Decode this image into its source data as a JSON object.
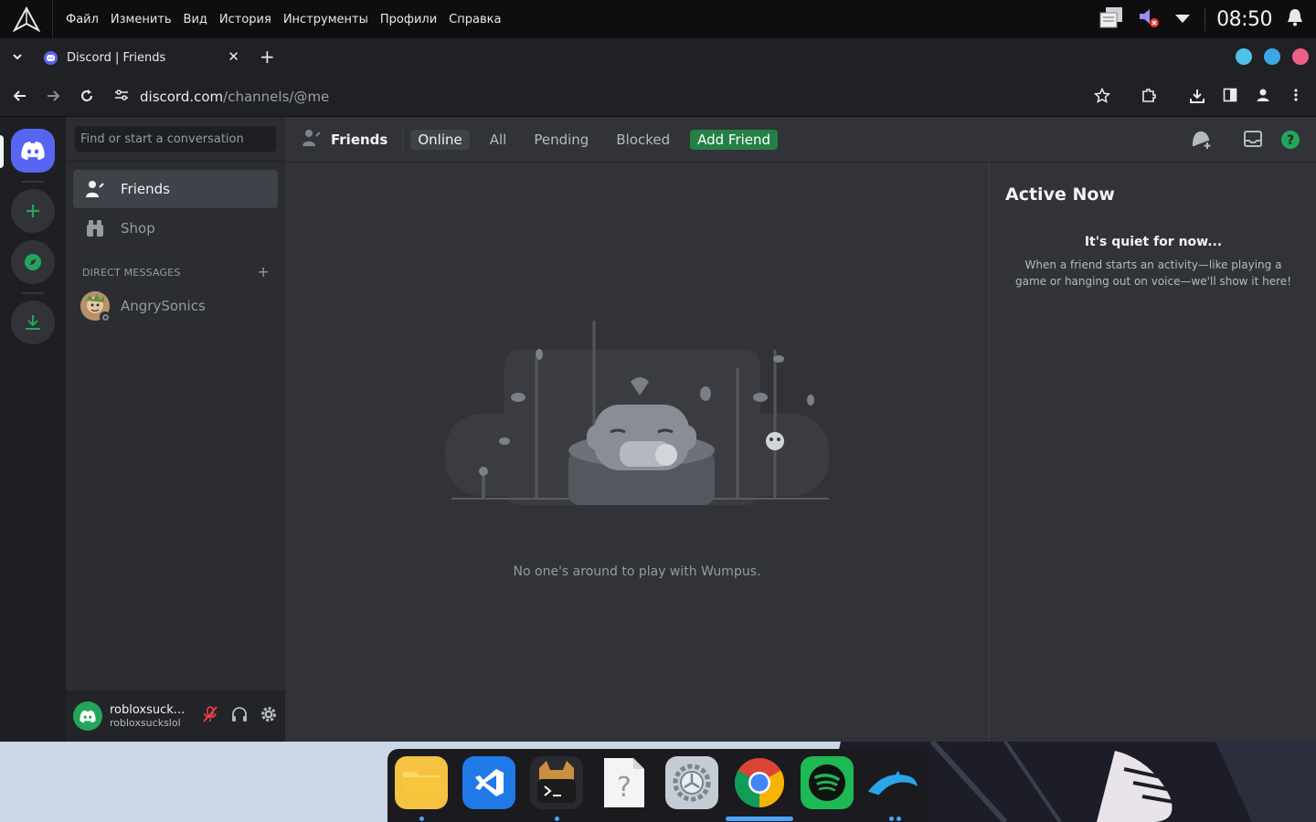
{
  "os": {
    "menu": [
      "Файл",
      "Изменить",
      "Вид",
      "История",
      "Инструменты",
      "Профили",
      "Справка"
    ],
    "clock": "08:50"
  },
  "browser": {
    "tab_title": "Discord | Friends",
    "url_host": "discord.com",
    "url_path": "/channels/@me",
    "profile_dot_colors": [
      "#4fc3e8",
      "#3ea6e8",
      "#ef5f8a"
    ]
  },
  "discord": {
    "search_placeholder": "Find or start a conversation",
    "nav": {
      "friends": "Friends",
      "shop": "Shop"
    },
    "dm_header": "DIRECT MESSAGES",
    "dm_add": "+",
    "dms": [
      {
        "name": "AngrySonics"
      }
    ],
    "user": {
      "display": "robloxsuck...",
      "username": "robloxsuckslol"
    },
    "header": {
      "title": "Friends",
      "tabs": [
        "Online",
        "All",
        "Pending",
        "Blocked"
      ],
      "add_friend": "Add Friend"
    },
    "empty_text": "No one's around to play with Wumpus.",
    "active_now": {
      "title": "Active Now",
      "quiet_title": "It's quiet for now...",
      "quiet_body": "When a friend starts an activity—like playing a game or hanging out on voice—we'll show it here!"
    }
  },
  "colors": {
    "blurple": "#5865f2",
    "green": "#23a55a",
    "add_friend": "#248046"
  }
}
